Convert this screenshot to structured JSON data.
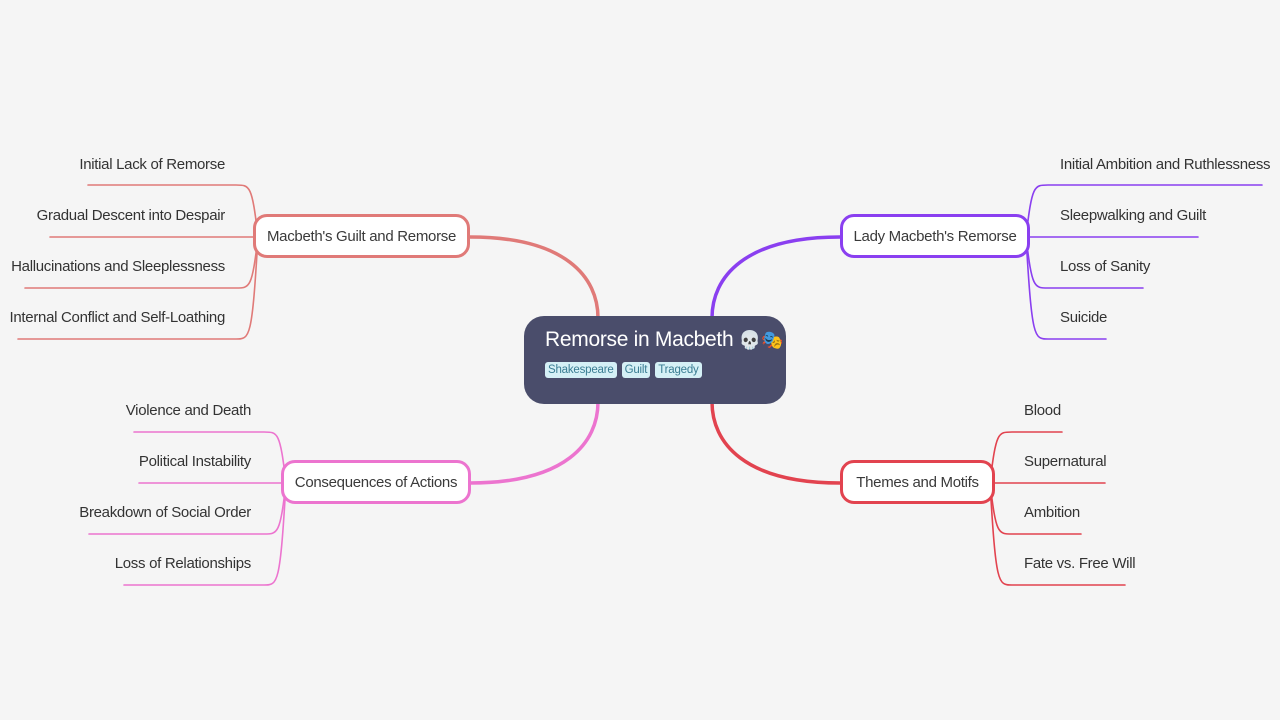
{
  "root": {
    "title": "Remorse in Macbeth",
    "emoji": "💀🎭",
    "tags": [
      "Shakespeare",
      "Guilt",
      "Tragedy"
    ]
  },
  "branches": [
    {
      "id": "macbeth-guilt",
      "label": "Macbeth's Guilt and Remorse",
      "side": "left",
      "color": "#e07a78",
      "children": [
        "Initial Lack of Remorse",
        "Gradual Descent into Despair",
        "Hallucinations and Sleeplessness",
        "Internal Conflict and Self-Loathing"
      ]
    },
    {
      "id": "lady-macbeth",
      "label": "Lady Macbeth's Remorse",
      "side": "right",
      "color": "#8a3ff0",
      "children": [
        "Initial Ambition and Ruthlessness",
        "Sleepwalking and Guilt",
        "Loss of Sanity",
        "Suicide"
      ]
    },
    {
      "id": "consequences",
      "label": "Consequences of Actions",
      "side": "left",
      "color": "#ec74cf",
      "children": [
        "Violence and Death",
        "Political Instability",
        "Breakdown of Social Order",
        "Loss of Relationships"
      ]
    },
    {
      "id": "themes",
      "label": "Themes and Motifs",
      "side": "right",
      "color": "#e2434f",
      "children": [
        "Blood",
        "Supernatural",
        "Ambition",
        "Fate vs. Free Will"
      ]
    }
  ]
}
